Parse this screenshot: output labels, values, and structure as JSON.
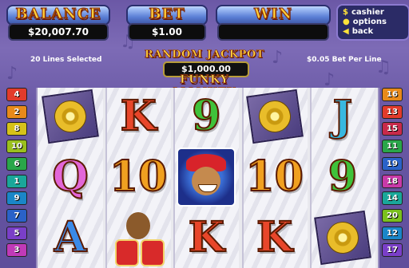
{
  "header": {
    "balance_label": "BALANCE",
    "balance_value": "$20,007.70",
    "bet_label": "BET",
    "bet_value": "$1.00",
    "win_label": "WIN",
    "win_value": ""
  },
  "menu": {
    "items": [
      {
        "label": "cashier",
        "icon": "dollar-icon"
      },
      {
        "label": "options",
        "icon": "circle-icon"
      },
      {
        "label": "back",
        "icon": "arrow-left-icon"
      }
    ]
  },
  "info": {
    "lines_selected": "20 Lines Selected",
    "bet_per_line": "$0.05 Bet Per Line"
  },
  "jackpot": {
    "title": "RANDOM JACKPOT",
    "value": "$1,000.00"
  },
  "game_title": "FUNKY MONKEY",
  "line_tabs": {
    "left": [
      {
        "num": "4",
        "color": "#e23b2b"
      },
      {
        "num": "2",
        "color": "#e88a1a"
      },
      {
        "num": "8",
        "color": "#d6c21a"
      },
      {
        "num": "10",
        "color": "#9ac01e"
      },
      {
        "num": "6",
        "color": "#2aa64a"
      },
      {
        "num": "1",
        "color": "#1aa79a"
      },
      {
        "num": "9",
        "color": "#1a86c8"
      },
      {
        "num": "7",
        "color": "#2a62c8"
      },
      {
        "num": "5",
        "color": "#7a3fc8"
      },
      {
        "num": "3",
        "color": "#c03ab8"
      }
    ],
    "right": [
      {
        "num": "16",
        "color": "#e88a1a"
      },
      {
        "num": "13",
        "color": "#e23b2b"
      },
      {
        "num": "15",
        "color": "#c82a4a"
      },
      {
        "num": "11",
        "color": "#2aa64a"
      },
      {
        "num": "19",
        "color": "#2a62c8"
      },
      {
        "num": "18",
        "color": "#c83aa8"
      },
      {
        "num": "14",
        "color": "#1aa79a"
      },
      {
        "num": "20",
        "color": "#7ac01e"
      },
      {
        "num": "12",
        "color": "#1a86c8"
      },
      {
        "num": "17",
        "color": "#7a3fc8"
      }
    ]
  },
  "reels": [
    [
      {
        "symbol": "record"
      },
      {
        "symbol": "Q",
        "color": "#e266d8"
      },
      {
        "symbol": "A",
        "color": "#3a8ae8"
      }
    ],
    [
      {
        "symbol": "K",
        "color": "#e8462a"
      },
      {
        "symbol": "10",
        "color": "#f0a020"
      },
      {
        "symbol": "drummer"
      }
    ],
    [
      {
        "symbol": "9",
        "color": "#3fc23a"
      },
      {
        "symbol": "monkey"
      },
      {
        "symbol": "K",
        "color": "#e8462a"
      }
    ],
    [
      {
        "symbol": "record"
      },
      {
        "symbol": "10",
        "color": "#f0a020"
      },
      {
        "symbol": "K",
        "color": "#e8462a"
      }
    ],
    [
      {
        "symbol": "J",
        "color": "#38b8e0"
      },
      {
        "symbol": "9",
        "color": "#3fc23a"
      },
      {
        "symbol": "record"
      }
    ]
  ]
}
